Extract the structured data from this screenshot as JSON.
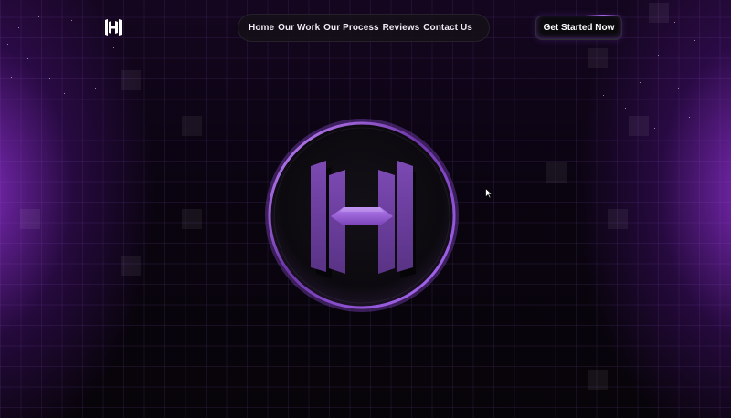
{
  "nav": {
    "items": [
      {
        "label": "Home"
      },
      {
        "label": "Our Work"
      },
      {
        "label": "Our Process"
      },
      {
        "label": "Reviews"
      },
      {
        "label": "Contact Us"
      }
    ]
  },
  "header": {
    "cta_label": "Get Started Now"
  },
  "icons": {
    "brand_logo": "h-monogram-icon",
    "hero_emblem": "h-monogram-emblem",
    "cursor": "mouse-pointer-icon"
  },
  "colors": {
    "background": "#050208",
    "accent_purple": "#8a4fc7",
    "glow_purple": "#9632dc",
    "text": "#ffffff"
  }
}
